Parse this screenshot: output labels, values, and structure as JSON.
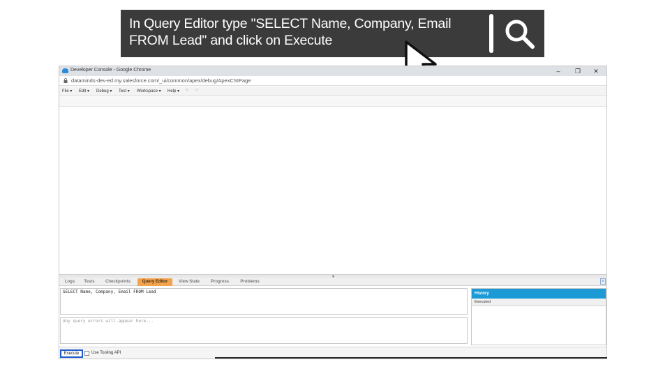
{
  "banner": {
    "text": "In Query Editor type \"SELECT Name, Company, Email FROM Lead\" and click on Execute",
    "icon": "search-icon",
    "background": "#3b3b3b"
  },
  "window": {
    "title": "Developer Console - Google Chrome",
    "url": "dataminds-dev-ed.my.salesforce.com/_ui/common/apex/debug/ApexCSIPage",
    "controls": {
      "minimize": "–",
      "maximize": "❐",
      "close": "✕"
    }
  },
  "menu": {
    "items": [
      "File ▾",
      "Edit ▾",
      "Debug ▾",
      "Test ▾",
      "Workspace ▾",
      "Help ▾"
    ],
    "back": "<",
    "forward": ">"
  },
  "panel": {
    "tabs": [
      "Logs",
      "Tests",
      "Checkpoints",
      "Query Editor",
      "View State",
      "Progress",
      "Problems"
    ],
    "active_tab": "Query Editor",
    "active_color": "#f3a34d"
  },
  "query": {
    "text": "SELECT Name, Company, Email FROM Lead",
    "errors_placeholder": "Any query errors will appear here..."
  },
  "history": {
    "title": "History",
    "column": "Executed",
    "header_color": "#1b9ad6"
  },
  "footer": {
    "execute_label": "Execute",
    "tooling_label": "Use Tooling API"
  }
}
